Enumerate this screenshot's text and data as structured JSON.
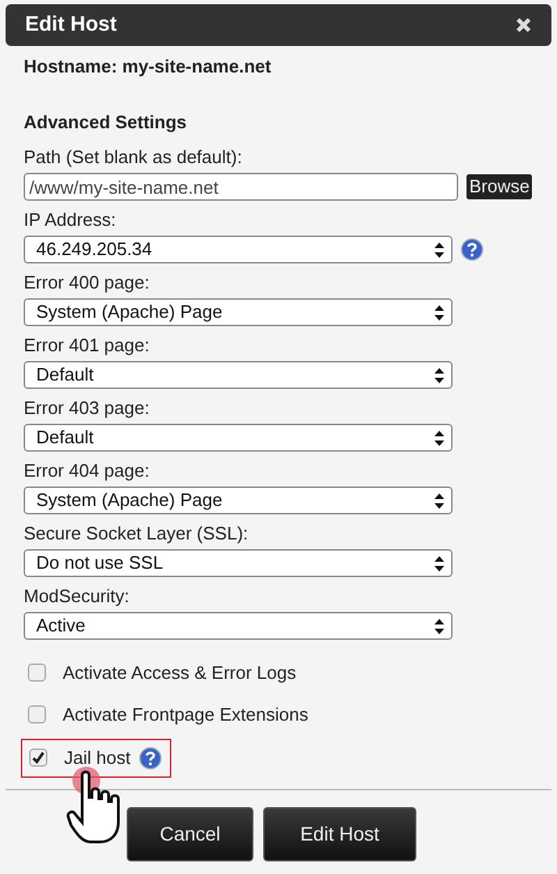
{
  "window": {
    "title": "Edit Host"
  },
  "hostname": "Hostname: my-site-name.net",
  "section_title": "Advanced Settings",
  "fields": [
    {
      "kind": "text",
      "label": "Path (Set blank as default):",
      "value": "/www/my-site-name.net",
      "button": "Browse"
    },
    {
      "kind": "select",
      "label": "IP Address:",
      "value": "46.249.205.34",
      "help": true
    },
    {
      "kind": "select",
      "label": "Error 400 page:",
      "value": "System (Apache) Page",
      "help": false
    },
    {
      "kind": "select",
      "label": "Error 401 page:",
      "value": "Default",
      "help": false
    },
    {
      "kind": "select",
      "label": "Error 403 page:",
      "value": "Default",
      "help": false
    },
    {
      "kind": "select",
      "label": "Error 404 page:",
      "value": "System (Apache) Page",
      "help": false
    },
    {
      "kind": "select",
      "label": "Secure Socket Layer (SSL):",
      "value": "Do not use SSL",
      "help": false
    },
    {
      "kind": "select",
      "label": "ModSecurity:",
      "value": "Active",
      "help": false
    }
  ],
  "checkboxes": [
    {
      "label": "Activate Access & Error Logs",
      "checked": false,
      "highlighted": false,
      "help": false
    },
    {
      "label": "Activate Frontpage Extensions",
      "checked": false,
      "highlighted": false,
      "help": false
    },
    {
      "label": "Jail host",
      "checked": true,
      "highlighted": true,
      "help": true
    }
  ],
  "buttons": [
    "Cancel",
    "Edit Host"
  ]
}
